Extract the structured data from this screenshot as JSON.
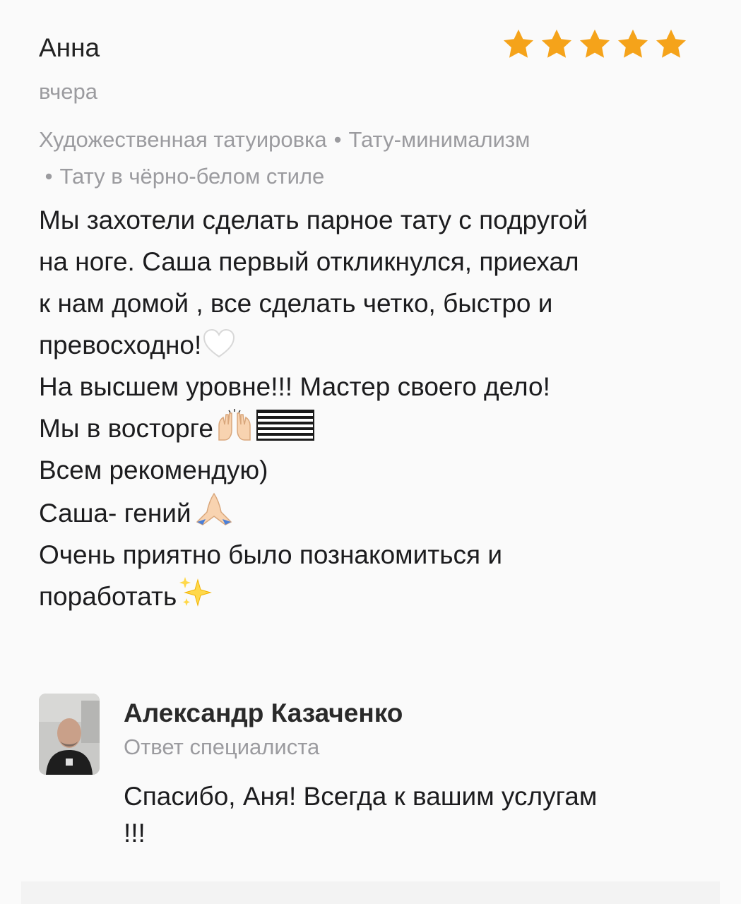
{
  "review": {
    "author": "Анна",
    "date": "вчера",
    "rating": 5,
    "star_color": "#f5a31a",
    "tags": [
      "Художественная татуировка",
      "Тату-минимализм",
      "Тату в чёрно-белом стиле"
    ],
    "tag_separator": "•",
    "lines": [
      "Мы захотели сделать парное тату с подругой",
      "на ноге. Саша первый откликнулся, приехал",
      "к нам домой , все сделать четко, быстро и",
      "превосходно!",
      "На высшем уровне!!! Мастер своего дело!",
      "Мы в восторге",
      "Всем рекомендую)",
      "Саша- гений",
      "Очень приятно было познакомиться и",
      "поработать"
    ],
    "emojis": {
      "white_heart": "white-heart-icon",
      "raised_hands": "raised-hands-icon",
      "flag": "flag-icon",
      "folded_hands": "folded-hands-icon",
      "sparkles": "sparkles-icon"
    }
  },
  "reply": {
    "author": "Александр Казаченко",
    "role": "Ответ специалиста",
    "text_line1": "Спасибо, Аня! Всегда к вашим услугам",
    "text_line2": "!!!"
  }
}
